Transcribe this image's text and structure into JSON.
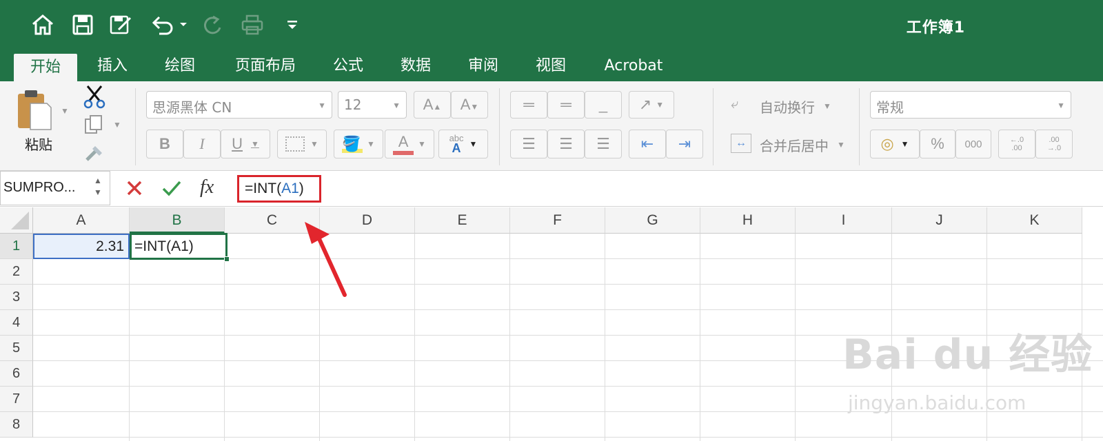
{
  "title": "工作簿1",
  "tabs": [
    "开始",
    "插入",
    "绘图",
    "页面布局",
    "公式",
    "数据",
    "审阅",
    "视图",
    "Acrobat"
  ],
  "clipboard": {
    "paste_label": "粘贴"
  },
  "font": {
    "name": "思源黑体 CN",
    "size": "12"
  },
  "alignment": {
    "wrap_label": "自动换行",
    "merge_label": "合并后居中"
  },
  "number": {
    "format": "常规",
    "percent": "%",
    "thousands": "000",
    "inc_decimal": "←.0\n.00",
    "dec_decimal": ".00\n→.0"
  },
  "name_box": "SUMPRO...",
  "formula": {
    "fx_label": "fx",
    "prefix": "=INT(",
    "ref": "A1",
    "suffix": ")"
  },
  "columns": [
    "A",
    "B",
    "C",
    "D",
    "E",
    "F",
    "G",
    "H",
    "I",
    "J",
    "K"
  ],
  "rows": [
    "1",
    "2",
    "3",
    "4",
    "5",
    "6",
    "7",
    "8"
  ],
  "cells": {
    "A1": "2.31",
    "B1": "=INT(A1)"
  },
  "colors": {
    "accent": "#217346",
    "highlight_border": "#d9242b",
    "arrow": "#e2262d",
    "ref_blue": "#2a6ebf"
  }
}
